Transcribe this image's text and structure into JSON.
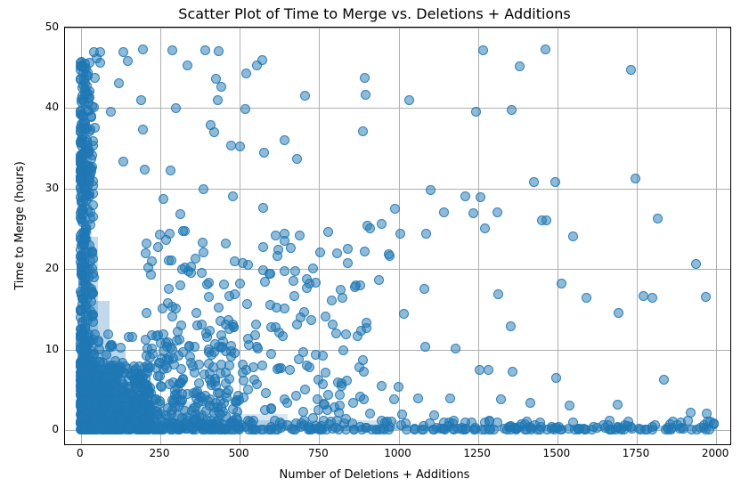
{
  "chart_data": {
    "type": "scatter",
    "title": "Scatter Plot of Time to Merge vs. Deletions + Additions",
    "xlabel": "Number of Deletions + Additions",
    "ylabel": "Time to Merge (hours)",
    "xlim": [
      -50,
      2050
    ],
    "ylim": [
      -2,
      50
    ],
    "xticks": [
      0,
      250,
      500,
      750,
      1000,
      1250,
      1500,
      1750,
      2000
    ],
    "yticks": [
      0,
      10,
      20,
      30,
      40,
      50
    ],
    "grid": true,
    "marker_color": "#1f77b4",
    "marker_alpha": 0.5,
    "approx_point_count": 3000,
    "distribution_note": "Very dense L-shaped cluster along the x-axis (x≈0–200, y≈0–8) and along the y-axis (x≈0–30 up to y≈47). Density thins rapidly with x and y. Scattered outliers across the whole 0–2000 × 0–50 range; a thin band of near-zero-hour merges runs along the entire bottom.",
    "sampled_outliers": [
      {
        "x": 42,
        "y": 47.0
      },
      {
        "x": 61,
        "y": 47.0
      },
      {
        "x": 134,
        "y": 47.0
      },
      {
        "x": 196,
        "y": 47.3
      },
      {
        "x": 287,
        "y": 47.2
      },
      {
        "x": 392,
        "y": 47.2
      },
      {
        "x": 435,
        "y": 47.1
      },
      {
        "x": 1266,
        "y": 47.2
      },
      {
        "x": 1463,
        "y": 47.3
      },
      {
        "x": 50,
        "y": 46.2
      },
      {
        "x": 61,
        "y": 45.6
      },
      {
        "x": 149,
        "y": 45.9
      },
      {
        "x": 336,
        "y": 45.3
      },
      {
        "x": 555,
        "y": 45.3
      },
      {
        "x": 570,
        "y": 46.0
      },
      {
        "x": 1381,
        "y": 45.2
      },
      {
        "x": 1731,
        "y": 44.7
      },
      {
        "x": 43,
        "y": 43.8
      },
      {
        "x": 119,
        "y": 43.1
      },
      {
        "x": 425,
        "y": 43.6
      },
      {
        "x": 442,
        "y": 42.6
      },
      {
        "x": 520,
        "y": 44.3
      },
      {
        "x": 894,
        "y": 43.8
      },
      {
        "x": 23,
        "y": 41.8
      },
      {
        "x": 190,
        "y": 41.0
      },
      {
        "x": 430,
        "y": 41.0
      },
      {
        "x": 705,
        "y": 41.5
      },
      {
        "x": 895,
        "y": 41.6
      },
      {
        "x": 1033,
        "y": 41.0
      },
      {
        "x": 21,
        "y": 39.8
      },
      {
        "x": 95,
        "y": 39.6
      },
      {
        "x": 41,
        "y": 40.1
      },
      {
        "x": 300,
        "y": 40.0
      },
      {
        "x": 517,
        "y": 39.9
      },
      {
        "x": 1243,
        "y": 39.5
      },
      {
        "x": 1355,
        "y": 39.8
      },
      {
        "x": 45,
        "y": 37.5
      },
      {
        "x": 195,
        "y": 37.3
      },
      {
        "x": 408,
        "y": 37.9
      },
      {
        "x": 421,
        "y": 37.0
      },
      {
        "x": 887,
        "y": 37.1
      },
      {
        "x": 472,
        "y": 35.3
      },
      {
        "x": 500,
        "y": 35.2
      },
      {
        "x": 577,
        "y": 34.5
      },
      {
        "x": 642,
        "y": 36.0
      },
      {
        "x": 679,
        "y": 33.7
      },
      {
        "x": 134,
        "y": 33.4
      },
      {
        "x": 200,
        "y": 32.3
      },
      {
        "x": 283,
        "y": 32.2
      },
      {
        "x": 1745,
        "y": 31.2
      },
      {
        "x": 1425,
        "y": 30.8
      },
      {
        "x": 1494,
        "y": 30.8
      },
      {
        "x": 1100,
        "y": 29.8
      },
      {
        "x": 385,
        "y": 29.9
      },
      {
        "x": 478,
        "y": 29.0
      },
      {
        "x": 1210,
        "y": 29.0
      },
      {
        "x": 1258,
        "y": 28.9
      },
      {
        "x": 261,
        "y": 28.7
      },
      {
        "x": 314,
        "y": 26.8
      },
      {
        "x": 575,
        "y": 27.6
      },
      {
        "x": 989,
        "y": 27.5
      },
      {
        "x": 1142,
        "y": 27.0
      },
      {
        "x": 1235,
        "y": 26.9
      },
      {
        "x": 1310,
        "y": 27.0
      },
      {
        "x": 1451,
        "y": 26.0
      },
      {
        "x": 1466,
        "y": 26.1
      },
      {
        "x": 1815,
        "y": 26.3
      },
      {
        "x": 903,
        "y": 25.4
      },
      {
        "x": 911,
        "y": 25.0
      },
      {
        "x": 1271,
        "y": 25.1
      },
      {
        "x": 640,
        "y": 24.4
      },
      {
        "x": 1088,
        "y": 24.4
      },
      {
        "x": 1550,
        "y": 24.1
      },
      {
        "x": 383,
        "y": 23.3
      },
      {
        "x": 385,
        "y": 22.1
      },
      {
        "x": 456,
        "y": 23.2
      },
      {
        "x": 575,
        "y": 22.7
      },
      {
        "x": 806,
        "y": 22.0
      },
      {
        "x": 948,
        "y": 25.6
      },
      {
        "x": 973,
        "y": 21.6
      },
      {
        "x": 1005,
        "y": 24.4
      },
      {
        "x": 508,
        "y": 20.7
      },
      {
        "x": 731,
        "y": 20.1
      },
      {
        "x": 970,
        "y": 21.8
      },
      {
        "x": 1936,
        "y": 20.6
      },
      {
        "x": 720,
        "y": 18.2
      },
      {
        "x": 740,
        "y": 18.3
      },
      {
        "x": 939,
        "y": 18.6
      },
      {
        "x": 1514,
        "y": 18.2
      },
      {
        "x": 711,
        "y": 17.6
      },
      {
        "x": 822,
        "y": 16.4
      },
      {
        "x": 1080,
        "y": 17.5
      },
      {
        "x": 1313,
        "y": 16.9
      },
      {
        "x": 1592,
        "y": 16.4
      },
      {
        "x": 1771,
        "y": 16.6
      },
      {
        "x": 1800,
        "y": 16.4
      },
      {
        "x": 1968,
        "y": 16.5
      },
      {
        "x": 256,
        "y": 15.1
      },
      {
        "x": 288,
        "y": 15.3
      },
      {
        "x": 523,
        "y": 15.6
      },
      {
        "x": 595,
        "y": 15.5
      },
      {
        "x": 642,
        "y": 15.1
      },
      {
        "x": 692,
        "y": 14.0
      },
      {
        "x": 703,
        "y": 14.7
      },
      {
        "x": 1018,
        "y": 14.4
      },
      {
        "x": 1693,
        "y": 14.5
      },
      {
        "x": 468,
        "y": 12.6
      },
      {
        "x": 882,
        "y": 12.3
      },
      {
        "x": 1354,
        "y": 12.9
      },
      {
        "x": 260,
        "y": 11.9
      },
      {
        "x": 527,
        "y": 11.3
      },
      {
        "x": 420,
        "y": 9.7
      },
      {
        "x": 441,
        "y": 10.2
      },
      {
        "x": 474,
        "y": 10.5
      },
      {
        "x": 553,
        "y": 10.3
      },
      {
        "x": 1085,
        "y": 10.3
      },
      {
        "x": 1179,
        "y": 10.1
      },
      {
        "x": 570,
        "y": 8.0
      },
      {
        "x": 631,
        "y": 7.7
      },
      {
        "x": 1256,
        "y": 7.5
      },
      {
        "x": 1284,
        "y": 7.5
      },
      {
        "x": 1358,
        "y": 7.2
      },
      {
        "x": 1496,
        "y": 6.5
      },
      {
        "x": 1835,
        "y": 6.2
      },
      {
        "x": 423,
        "y": 6.0
      },
      {
        "x": 467,
        "y": 6.3
      },
      {
        "x": 512,
        "y": 6.1
      },
      {
        "x": 555,
        "y": 5.7
      },
      {
        "x": 705,
        "y": 5.0
      },
      {
        "x": 763,
        "y": 5.7
      },
      {
        "x": 820,
        "y": 5.5
      },
      {
        "x": 946,
        "y": 5.5
      },
      {
        "x": 1000,
        "y": 5.4
      },
      {
        "x": 320,
        "y": 4.5
      },
      {
        "x": 374,
        "y": 4.1
      },
      {
        "x": 430,
        "y": 4.6
      },
      {
        "x": 496,
        "y": 4.3
      },
      {
        "x": 583,
        "y": 4.6
      },
      {
        "x": 678,
        "y": 4.2
      },
      {
        "x": 779,
        "y": 4.4
      },
      {
        "x": 880,
        "y": 4.1
      },
      {
        "x": 985,
        "y": 3.8
      },
      {
        "x": 1063,
        "y": 3.9
      },
      {
        "x": 1163,
        "y": 3.9
      },
      {
        "x": 1323,
        "y": 3.8
      },
      {
        "x": 1415,
        "y": 3.4
      },
      {
        "x": 1537,
        "y": 3.0
      },
      {
        "x": 1690,
        "y": 3.1
      },
      {
        "x": 1920,
        "y": 2.1
      },
      {
        "x": 1970,
        "y": 2.0
      },
      {
        "x": 1982,
        "y": 1.0
      },
      {
        "x": 600,
        "y": 2.6
      },
      {
        "x": 700,
        "y": 2.3
      },
      {
        "x": 812,
        "y": 2.2
      },
      {
        "x": 910,
        "y": 2.0
      },
      {
        "x": 1012,
        "y": 1.9
      },
      {
        "x": 1112,
        "y": 1.8
      },
      {
        "x": 300,
        "y": 0.2
      },
      {
        "x": 450,
        "y": 0.2
      },
      {
        "x": 600,
        "y": 0.4
      },
      {
        "x": 750,
        "y": 0.3
      },
      {
        "x": 900,
        "y": 0.3
      },
      {
        "x": 1050,
        "y": 0.2
      },
      {
        "x": 1200,
        "y": 0.3
      },
      {
        "x": 1350,
        "y": 0.4
      },
      {
        "x": 1500,
        "y": 0.3
      },
      {
        "x": 1650,
        "y": 0.3
      },
      {
        "x": 1800,
        "y": 0.4
      },
      {
        "x": 1950,
        "y": 0.3
      },
      {
        "x": 5,
        "y": 12.0
      },
      {
        "x": 8,
        "y": 18.0
      },
      {
        "x": 12,
        "y": 24.0
      },
      {
        "x": 14,
        "y": 30.0
      },
      {
        "x": 20,
        "y": 36.0
      },
      {
        "x": 22,
        "y": 44.0
      }
    ]
  }
}
